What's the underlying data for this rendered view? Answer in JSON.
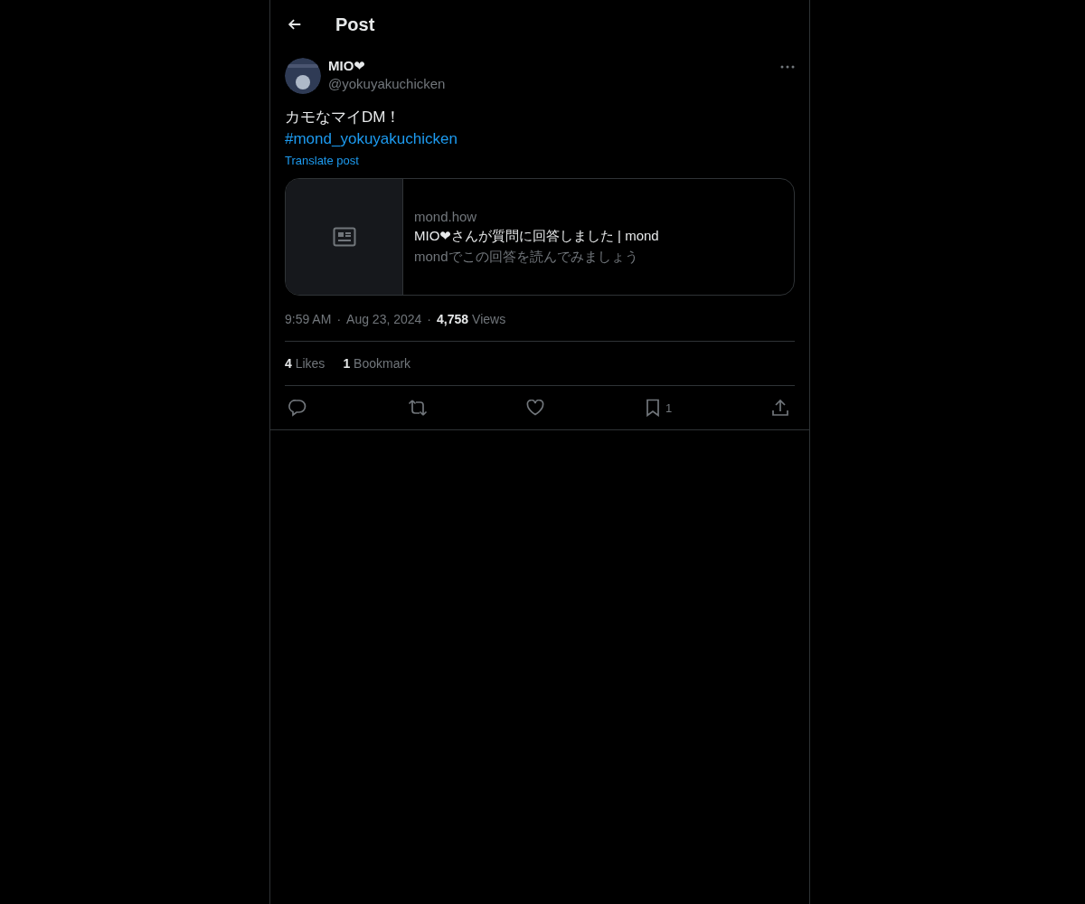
{
  "header": {
    "title": "Post"
  },
  "author": {
    "name": "MIO❤",
    "handle": "@yokuyakuchicken"
  },
  "post": {
    "text": "カモなマイDM！",
    "hashtag": "#mond_yokuyakuchicken",
    "translate": "Translate post"
  },
  "card": {
    "domain": "mond.how",
    "title": "MIO❤さんが質問に回答しました | mond",
    "description": "mondでこの回答を読んでみましょう"
  },
  "meta": {
    "time": "9:59 AM",
    "separator_1": "·",
    "date": "Aug 23, 2024",
    "separator_2": "·",
    "views_count": "4,758",
    "views_label": "Views"
  },
  "stats": [
    {
      "count": "4",
      "label": "Likes"
    },
    {
      "count": "1",
      "label": "Bookmark"
    }
  ],
  "actions": [
    {
      "kind": "reply"
    },
    {
      "kind": "repost"
    },
    {
      "kind": "like"
    },
    {
      "kind": "bookmark",
      "count": "1"
    },
    {
      "kind": "share"
    }
  ]
}
